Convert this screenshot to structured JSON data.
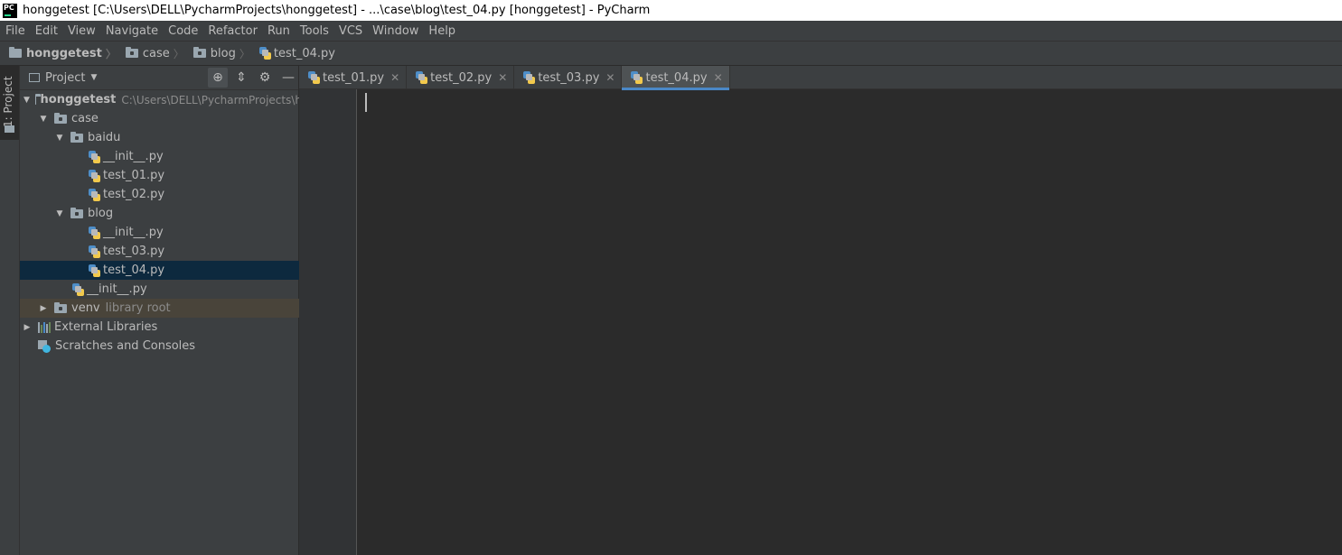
{
  "window": {
    "title": "honggetest [C:\\Users\\DELL\\PycharmProjects\\honggetest] - ...\\case\\blog\\test_04.py [honggetest] - PyCharm",
    "logo_text": "PC"
  },
  "menu": [
    "File",
    "Edit",
    "View",
    "Navigate",
    "Code",
    "Refactor",
    "Run",
    "Tools",
    "VCS",
    "Window",
    "Help"
  ],
  "breadcrumb": [
    "honggetest",
    "case",
    "blog",
    "test_04.py"
  ],
  "left_tool_window": {
    "label": "1: Project"
  },
  "project_panel": {
    "view_label": "Project",
    "tree": [
      {
        "label": "honggetest",
        "path": "C:\\Users\\DELL\\PycharmProjects\\h",
        "type": "folder",
        "expanded": true,
        "depth": 0
      },
      {
        "label": "case",
        "type": "folder",
        "expanded": true,
        "depth": 1
      },
      {
        "label": "baidu",
        "type": "folder",
        "expanded": true,
        "depth": 2
      },
      {
        "label": "__init__.py",
        "type": "py",
        "depth": 3
      },
      {
        "label": "test_01.py",
        "type": "py",
        "depth": 3
      },
      {
        "label": "test_02.py",
        "type": "py",
        "depth": 3
      },
      {
        "label": "blog",
        "type": "folder",
        "expanded": true,
        "depth": 2
      },
      {
        "label": "__init__.py",
        "type": "py",
        "depth": 3
      },
      {
        "label": "test_03.py",
        "type": "py",
        "depth": 3
      },
      {
        "label": "test_04.py",
        "type": "py",
        "depth": 3,
        "selected": true
      },
      {
        "label": "__init__.py",
        "type": "py",
        "depth": 2
      },
      {
        "label": "venv",
        "suffix": "library root",
        "type": "folder",
        "expanded": false,
        "depth": 1,
        "excluded": true
      },
      {
        "label": "External Libraries",
        "type": "library",
        "expanded": false,
        "depth": 0
      },
      {
        "label": "Scratches and Consoles",
        "type": "scratch",
        "depth": 0
      }
    ]
  },
  "editor": {
    "tabs": [
      {
        "label": "test_01.py",
        "active": false
      },
      {
        "label": "test_02.py",
        "active": false
      },
      {
        "label": "test_03.py",
        "active": false
      },
      {
        "label": "test_04.py",
        "active": true
      }
    ],
    "content": ""
  },
  "colors": {
    "background": "#2b2b2b",
    "panel": "#3c3f41",
    "selection": "#0d293e",
    "excluded": "#49443a",
    "active_tab_underline": "#4a88c7"
  }
}
